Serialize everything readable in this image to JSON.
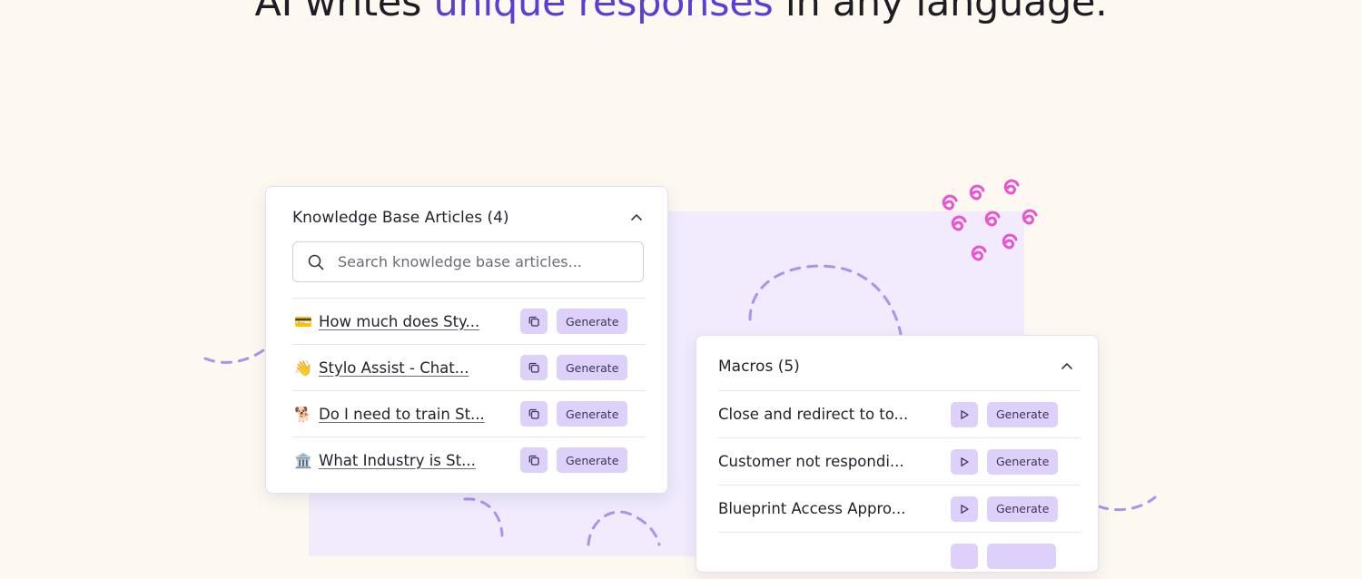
{
  "headline": {
    "prefix": "AI writes ",
    "accent": "unique responses",
    "suffix": " in any language."
  },
  "colors": {
    "background": "#fdf9f1",
    "accent": "#5b3fd4",
    "lilac": "#f1ebfd",
    "button": "#ddd0fb",
    "squiggle_pink": "#e855d0",
    "dash_purple": "#a994ec"
  },
  "knowledge_base": {
    "title": "Knowledge Base Articles (4)",
    "search_placeholder": "Search knowledge base articles...",
    "items": [
      {
        "emoji": "💳",
        "label": "How much does Sty...",
        "action": "Generate",
        "icon": "copy-icon"
      },
      {
        "emoji": "👋",
        "label": "Stylo Assist - Chat...",
        "action": "Generate",
        "icon": "copy-icon"
      },
      {
        "emoji": "🐕",
        "label": "Do I need to train St...",
        "action": "Generate",
        "icon": "copy-icon"
      },
      {
        "emoji": "🏛️",
        "label": "What Industry is St...",
        "action": "Generate",
        "icon": "copy-icon"
      }
    ]
  },
  "macros": {
    "title": "Macros (5)",
    "items": [
      {
        "label": "Close and redirect to to...",
        "action": "Generate",
        "icon": "play-icon"
      },
      {
        "label": "Customer not respondi...",
        "action": "Generate",
        "icon": "play-icon"
      },
      {
        "label": "Blueprint Access Appro...",
        "action": "Generate",
        "icon": "play-icon"
      },
      {
        "label": "",
        "action": "",
        "icon": "play-icon"
      }
    ]
  }
}
